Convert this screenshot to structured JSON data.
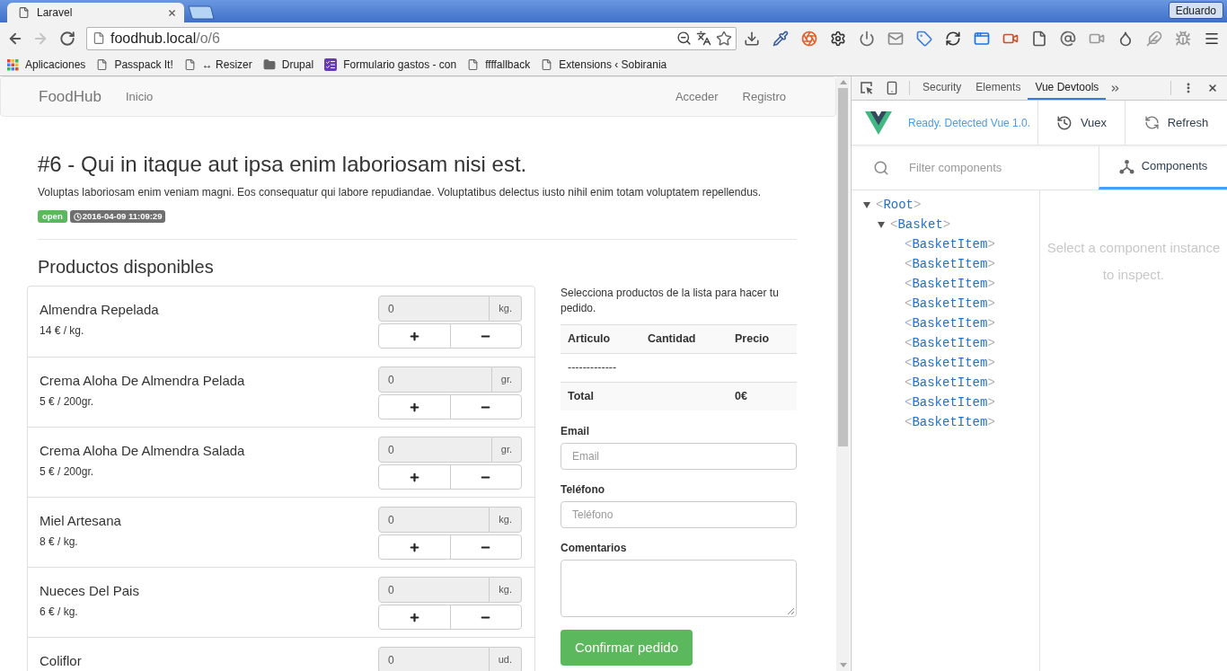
{
  "browser": {
    "tabs": [
      {
        "title": "Laravel",
        "selected": true
      }
    ],
    "profile": "Eduardo",
    "back": {
      "disabled": false
    },
    "forward": {
      "disabled": true
    },
    "address": {
      "host": "foodhub.local",
      "path": "/o/6"
    },
    "bookmarks": [
      {
        "kind": "apps",
        "label": "Aplicaciones"
      },
      {
        "kind": "page",
        "label": "Passpack It!"
      },
      {
        "kind": "page",
        "label": "↔ Resizer"
      },
      {
        "kind": "folder",
        "label": "Drupal"
      },
      {
        "kind": "form",
        "label": "Formulario gastos - con"
      },
      {
        "kind": "page",
        "label": "ffffallback"
      },
      {
        "kind": "page",
        "label": "Extensions ‹ Sobirania"
      }
    ]
  },
  "navbar": {
    "brand": "FoodHub",
    "left_links": [
      {
        "label": "Inicio"
      }
    ],
    "right_links": [
      {
        "label": "Acceder"
      },
      {
        "label": "Registro"
      }
    ]
  },
  "order": {
    "title": "#6 - Qui in itaque aut ipsa enim laboriosam nisi est.",
    "description": "Voluptas laboriosam enim veniam magni. Eos consequatur qui labore repudiandae. Voluptatibus delectus iusto nihil enim totam voluptatem repellendus.",
    "badges": [
      {
        "kind": "status",
        "label": "open"
      },
      {
        "kind": "date",
        "label": "2016-04-09 11:09:29"
      }
    ]
  },
  "products": {
    "heading": "Productos disponibles",
    "items": [
      {
        "name": "Almendra Repelada",
        "price": "14 € / kg.",
        "quantity": "0",
        "unit": "kg.",
        "buttons": [
          {
            "kind": "plus"
          },
          {
            "kind": "minus"
          }
        ]
      },
      {
        "name": "Crema Aloha De Almendra Pelada",
        "price": "5 € / 200gr.",
        "quantity": "0",
        "unit": "gr.",
        "buttons": [
          {
            "kind": "plus"
          },
          {
            "kind": "minus"
          }
        ]
      },
      {
        "name": "Crema Aloha De Almendra Salada",
        "price": "5 € / 200gr.",
        "quantity": "0",
        "unit": "gr.",
        "buttons": [
          {
            "kind": "plus"
          },
          {
            "kind": "minus"
          }
        ]
      },
      {
        "name": "Miel Artesana",
        "price": "8 € / kg.",
        "quantity": "0",
        "unit": "kg.",
        "buttons": [
          {
            "kind": "plus"
          },
          {
            "kind": "minus"
          }
        ]
      },
      {
        "name": "Nueces Del Pais",
        "price": "6 € / kg.",
        "quantity": "0",
        "unit": "kg.",
        "buttons": [
          {
            "kind": "plus"
          },
          {
            "kind": "minus"
          }
        ]
      },
      {
        "name": "Coliflor",
        "quantity": "0",
        "unit": "ud."
      }
    ]
  },
  "basket": {
    "intro": "Selecciona productos de la lista para hacer tu pedido.",
    "columns": [
      "Articulo",
      "Cantidad",
      "Precio"
    ],
    "rows": [
      [
        "-------------"
      ]
    ],
    "total": {
      "label": "Total",
      "value": "0€"
    },
    "fields": [
      {
        "kind": "input",
        "label": "Email",
        "placeholder": "Email"
      },
      {
        "kind": "input",
        "label": "Teléfono",
        "placeholder": "Teléfono"
      },
      {
        "kind": "textarea",
        "label": "Comentarios"
      }
    ],
    "submit": "Confirmar pedido"
  },
  "devtools": {
    "tabs": [
      {
        "label": "Security",
        "selected": false
      },
      {
        "label": "Elements",
        "selected": false
      },
      {
        "label": "Vue Devtools",
        "selected": true
      }
    ],
    "status": "Ready. Detected Vue 1.0.",
    "actions": [
      {
        "kind": "history",
        "label": "Vuex"
      },
      {
        "kind": "refresh",
        "label": "Refresh"
      }
    ],
    "filter_placeholder": "Filter components",
    "view_tabs": [
      {
        "label": "Components",
        "selected": true
      }
    ],
    "tree": [
      {
        "open": "<",
        "name": "Root",
        "close": ">",
        "expanded": true,
        "children": [
          {
            "open": "<",
            "name": "Basket",
            "close": ">",
            "expanded": true,
            "children": [
              {
                "open": "<",
                "name": "BasketItem",
                "close": ">"
              },
              {
                "open": "<",
                "name": "BasketItem",
                "close": ">"
              },
              {
                "open": "<",
                "name": "BasketItem",
                "close": ">"
              },
              {
                "open": "<",
                "name": "BasketItem",
                "close": ">"
              },
              {
                "open": "<",
                "name": "BasketItem",
                "close": ">"
              },
              {
                "open": "<",
                "name": "BasketItem",
                "close": ">"
              },
              {
                "open": "<",
                "name": "BasketItem",
                "close": ">"
              },
              {
                "open": "<",
                "name": "BasketItem",
                "close": ">"
              },
              {
                "open": "<",
                "name": "BasketItem",
                "close": ">"
              },
              {
                "open": "<",
                "name": "BasketItem",
                "close": ">"
              }
            ]
          }
        ]
      }
    ],
    "inspector_hint": "Select a component instance to inspect."
  }
}
